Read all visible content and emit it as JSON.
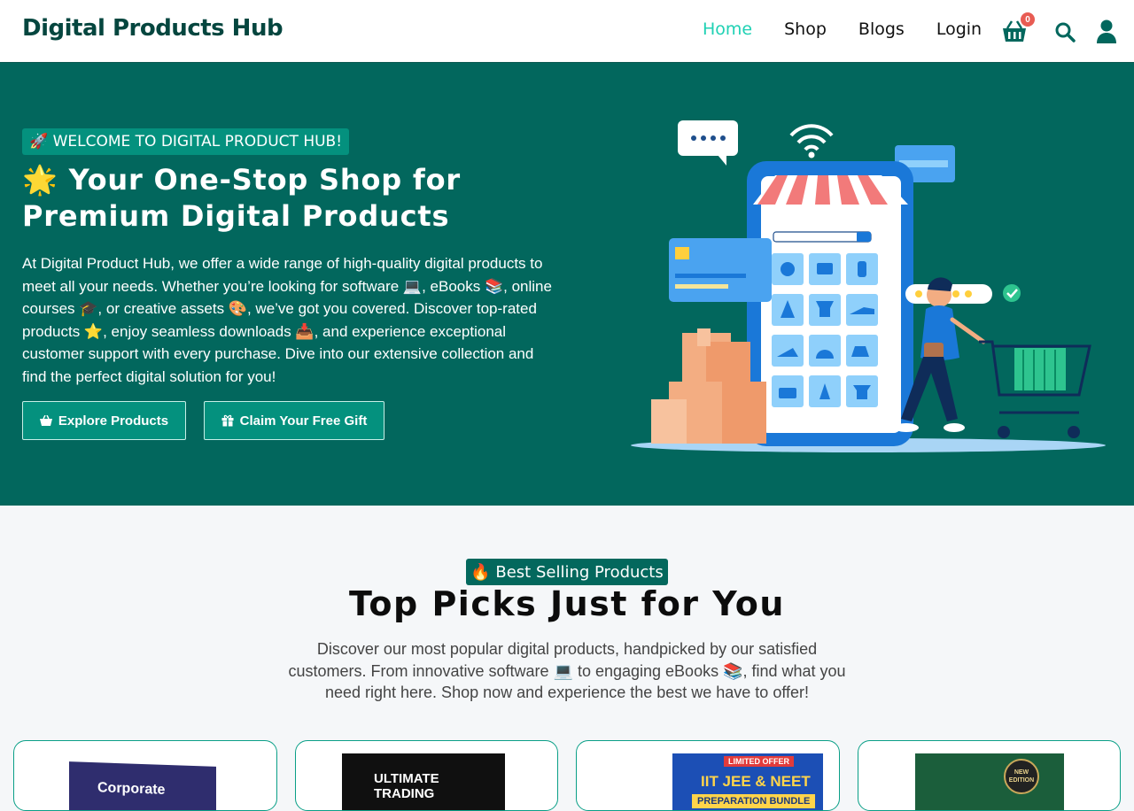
{
  "header": {
    "brand": "Digital Products Hub",
    "nav": [
      {
        "label": "Home",
        "active": true
      },
      {
        "label": "Shop"
      },
      {
        "label": "Blogs"
      },
      {
        "label": "Login"
      }
    ],
    "cart_count": "0"
  },
  "hero": {
    "welcome": "🚀 WELCOME TO DIGITAL PRODUCT HUB!",
    "title": "🌟 Your One-Stop Shop for Premium Digital Products",
    "description": "At Digital Product Hub, we offer a wide range of high-quality digital products to meet all your needs. Whether you’re looking for software 💻, eBooks 📚, online courses 🎓, or creative assets 🎨, we’ve got you covered. Discover top-rated products ⭐, enjoy seamless downloads 📥, and experience exceptional customer support with every purchase. Dive into our extensive collection and find the perfect digital solution for you!",
    "buttons": {
      "explore": "Explore Products",
      "gift": "Claim Your Free Gift"
    }
  },
  "best_selling": {
    "tag": "🔥 Best Selling Products",
    "title": "Top Picks Just for You",
    "description": "Discover our most popular digital products, handpicked by our satisfied customers. From innovative software 💻 to engaging eBooks 📚, find what you need right here. Shop now and experience the best we have to offer!"
  },
  "products": [
    {
      "cover_text": "Corporate"
    },
    {
      "cover_text": "ULTIMATE TRADING"
    },
    {
      "cover_text": "IIT JEE & NEET",
      "badge": "LIMITED OFFER",
      "sub": "PREPARATION BUNDLE"
    },
    {
      "badge": "NEW EDITION"
    }
  ],
  "colors": {
    "primary": "#02675d",
    "accent": "#04917e",
    "nav_active": "#1fd1b4",
    "badge": "#e85c53"
  },
  "icons": [
    "shopping-basket-icon",
    "search-icon",
    "user-icon",
    "basket-icon",
    "gift-icon"
  ]
}
